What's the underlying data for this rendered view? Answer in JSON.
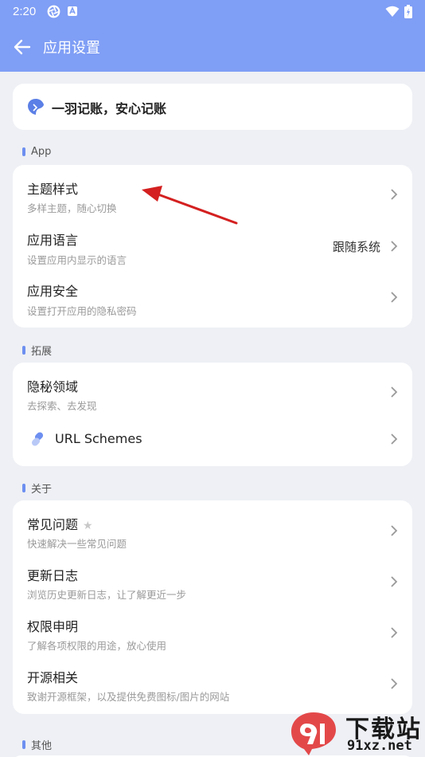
{
  "status_bar": {
    "time": "2:20"
  },
  "app_bar": {
    "title": "应用设置"
  },
  "banner": {
    "text": "一羽记账，安心记账"
  },
  "sections": {
    "app": {
      "label": "App",
      "items": [
        {
          "title": "主题样式",
          "subtitle": "多样主题，随心切换"
        },
        {
          "title": "应用语言",
          "subtitle": "设置应用内显示的语言",
          "value": "跟随系统"
        },
        {
          "title": "应用安全",
          "subtitle": "设置打开应用的隐私密码"
        }
      ]
    },
    "extend": {
      "label": "拓展",
      "items": [
        {
          "title": "隐秘领域",
          "subtitle": "去探索、去发现"
        },
        {
          "title": "URL Schemes"
        }
      ]
    },
    "about": {
      "label": "关于",
      "items": [
        {
          "title": "常见问题",
          "subtitle": "快速解决一些常见问题"
        },
        {
          "title": "更新日志",
          "subtitle": "浏览历史更新日志，让了解更近一步"
        },
        {
          "title": "权限申明",
          "subtitle": "了解各项权限的用途，放心使用"
        },
        {
          "title": "开源相关",
          "subtitle": "致谢开源框架，以及提供免费图标/图片的网站"
        }
      ]
    },
    "other": {
      "label": "其他"
    }
  },
  "watermark": {
    "cn": "下载站",
    "url": "91xz.net"
  },
  "colors": {
    "accent": "#7f9ef5",
    "background": "#eef0f5",
    "annotation_arrow": "#d42020"
  }
}
